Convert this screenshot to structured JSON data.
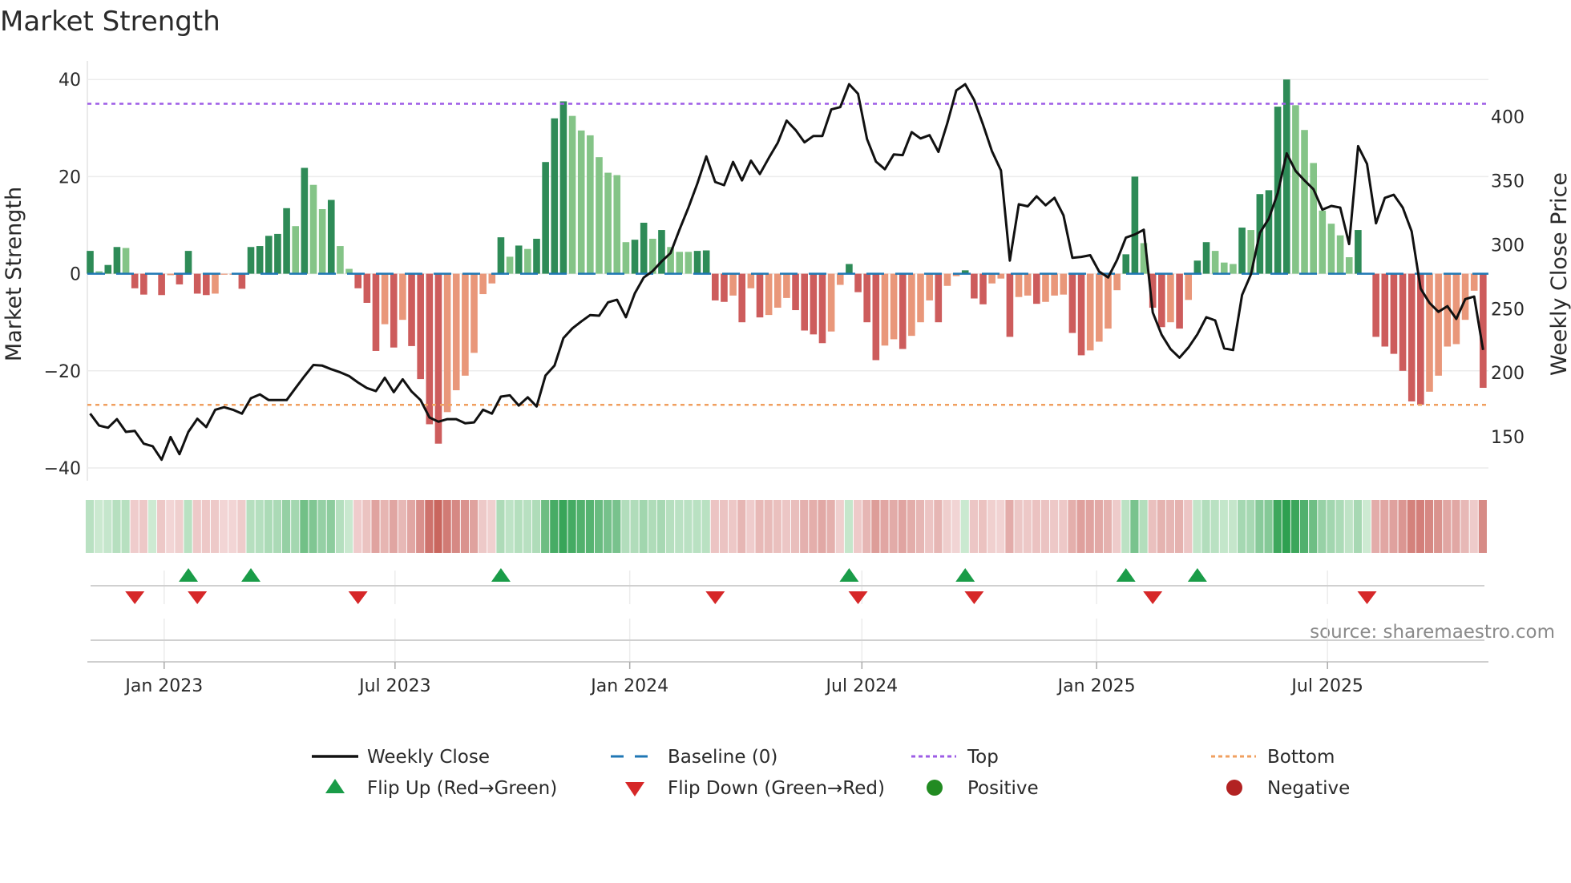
{
  "chart_data": {
    "type": "bar",
    "title": "Market Strength",
    "ylabel": "Market Strength",
    "y2label": "Weekly Close Price",
    "ylim": [
      -42,
      42
    ],
    "y2lim": [
      120,
      430
    ],
    "yticks": [
      40,
      20,
      0,
      -20,
      -40
    ],
    "yticklabels": [
      "40",
      "20",
      "0",
      "−20",
      "−40"
    ],
    "y2ticks": [
      400,
      350,
      300,
      250,
      200,
      150
    ],
    "y2ticklabels": [
      "400",
      "350",
      "300",
      "250",
      "200",
      "150"
    ],
    "x_start": "2022-11-04",
    "x_step_days": 7,
    "xticks": [
      "2023-01-01",
      "2023-07-01",
      "2024-01-01",
      "2024-07-01",
      "2025-01-01",
      "2025-07-01"
    ],
    "xticklabels": [
      "Jan 2023",
      "Jul 2023",
      "Jan 2024",
      "Jul 2024",
      "Jan 2025",
      "Jul 2025"
    ],
    "grid": true,
    "top_level": 35,
    "bottom_level": -27,
    "baseline": 0,
    "series": [
      {
        "name": "Market Strength",
        "values": [
          4.7,
          0.5,
          1.8,
          5.5,
          5.3,
          -3,
          -4.3,
          0,
          -4.4,
          -0.3,
          -2.2,
          4.7,
          -4.1,
          -4.4,
          -4.1,
          -0.2,
          -0.2,
          -3.1,
          5.5,
          5.7,
          7.8,
          8.2,
          13.5,
          9.8,
          21.8,
          18.3,
          13.3,
          15.2,
          5.7,
          1.0,
          -3,
          -6,
          -15.9,
          -10.4,
          -15.2,
          -9.5,
          -14.9,
          -21.7,
          -31,
          -35,
          -28.5,
          -24,
          -21,
          -16.3,
          -4.2,
          -2,
          7.5,
          3.5,
          5.8,
          5.1,
          7.2,
          23,
          32,
          35.5,
          32.5,
          29.5,
          28.5,
          24,
          20.8,
          20.3,
          6.5,
          7,
          10.5,
          7.2,
          9,
          5.5,
          4.5,
          4.5,
          4.7,
          4.8,
          -5.5,
          -5.8,
          -4.5,
          -10,
          -3,
          -9,
          -8.5,
          -7,
          -5,
          -7.5,
          -11.7,
          -12.5,
          -14.3,
          -11.9,
          -2.3,
          2,
          -3.8,
          -10,
          -17.8,
          -14.8,
          -13.5,
          -15.5,
          -12.8,
          -10,
          -5.5,
          -10,
          -2.5,
          -0.5,
          0.7,
          -5.1,
          -6.3,
          -2,
          -1,
          -13,
          -4.8,
          -4.5,
          -6.2,
          -5.8,
          -4.5,
          -4.3,
          -12.2,
          -16.8,
          -15.8,
          -14,
          -11.3,
          -3.4,
          4,
          20,
          6.3,
          -7,
          -11,
          -10,
          -11.3,
          -5.4,
          2.7,
          6.5,
          4.7,
          2.3,
          2,
          9.5,
          9,
          16.4,
          17.2,
          34.4,
          40,
          34.7,
          29.6,
          22.8,
          13,
          10.3,
          7.9,
          3.4,
          9,
          0,
          -13,
          -15,
          -16.5,
          -20,
          -26.3,
          -27,
          -24.3,
          -21,
          -15,
          -14.5,
          -9.5,
          -3.5,
          -23.5
        ],
        "shade": [
          "d",
          "l",
          "d",
          "d",
          "l",
          "d",
          "d",
          "d",
          "d",
          "l",
          "d",
          "d",
          "d",
          "d",
          "l",
          "l",
          "l",
          "d",
          "d",
          "d",
          "d",
          "d",
          "d",
          "l",
          "d",
          "l",
          "l",
          "d",
          "l",
          "l",
          "d",
          "d",
          "d",
          "l",
          "d",
          "l",
          "d",
          "d",
          "d",
          "d",
          "l",
          "l",
          "l",
          "l",
          "l",
          "l",
          "d",
          "l",
          "d",
          "l",
          "d",
          "d",
          "d",
          "d",
          "l",
          "l",
          "l",
          "l",
          "l",
          "l",
          "l",
          "d",
          "d",
          "l",
          "d",
          "l",
          "l",
          "l",
          "d",
          "d",
          "d",
          "d",
          "l",
          "d",
          "l",
          "d",
          "l",
          "l",
          "l",
          "d",
          "d",
          "d",
          "d",
          "l",
          "l",
          "d",
          "d",
          "d",
          "d",
          "l",
          "l",
          "d",
          "l",
          "l",
          "l",
          "d",
          "l",
          "l",
          "d",
          "d",
          "d",
          "l",
          "l",
          "d",
          "l",
          "l",
          "d",
          "l",
          "l",
          "l",
          "d",
          "d",
          "l",
          "l",
          "l",
          "l",
          "d",
          "d",
          "l",
          "d",
          "d",
          "l",
          "d",
          "l",
          "d",
          "d",
          "l",
          "l",
          "l",
          "d",
          "l",
          "d",
          "d",
          "d",
          "d",
          "l",
          "l",
          "l",
          "l",
          "l",
          "l",
          "l",
          "d",
          "d",
          "d",
          "d",
          "d",
          "d",
          "d",
          "d",
          "l",
          "l",
          "l",
          "l",
          "l",
          "l",
          "d"
        ]
      },
      {
        "name": "Weekly Close",
        "axis": "right",
        "values": [
          168,
          158.7,
          157,
          163.7,
          153.7,
          154.5,
          144.5,
          142.5,
          132,
          149.7,
          136.3,
          153.7,
          164,
          157.5,
          171,
          173,
          171,
          168,
          180,
          183,
          178.6,
          178.6,
          178.6,
          188,
          197.3,
          206,
          205.5,
          202.7,
          200.3,
          197.3,
          192.3,
          188,
          185.6,
          196,
          184.8,
          194.8,
          185.3,
          178.6,
          165,
          161.7,
          163.7,
          163.7,
          160.5,
          161.2,
          171,
          168,
          181.3,
          182.3,
          174.3,
          180.8,
          173.6,
          197.8,
          205.5,
          227,
          234.6,
          240,
          245,
          244.5,
          255,
          257,
          243.3,
          262,
          274.4,
          279.4,
          287,
          293.5,
          311.7,
          329,
          347.8,
          369,
          349,
          346.5,
          364.7,
          350.2,
          365.7,
          355.2,
          367.7,
          379.6,
          397,
          389.6,
          380,
          385,
          385,
          405.7,
          407.5,
          425.4,
          418,
          382.6,
          365,
          359,
          370.6,
          370,
          388,
          383,
          385.6,
          372.6,
          395,
          420.6,
          425.4,
          413,
          393.8,
          373,
          358,
          287.6,
          331.6,
          330,
          337.8,
          330.8,
          336.6,
          323,
          289.8,
          290.5,
          291.8,
          279,
          274.4,
          288,
          305.5,
          308,
          311.7,
          247,
          229.6,
          218.4,
          211.7,
          219.6,
          230,
          243.3,
          240.8,
          219,
          217.7,
          260.7,
          276.9,
          309.2,
          320.4,
          340.3,
          371.4,
          357.7,
          350.2,
          343.3,
          327.4,
          330.3,
          329,
          300.5,
          377,
          363.2,
          316.7,
          336.6,
          339,
          329,
          310.4,
          265.7,
          254.5,
          247.5,
          252,
          242,
          257.5,
          259.5,
          217.7
        ]
      }
    ],
    "flip_up_weeks": [
      11,
      18,
      46,
      85,
      98,
      116,
      124
    ],
    "flip_down_weeks": [
      5,
      12,
      30,
      70,
      86,
      99,
      119,
      143
    ],
    "legend": {
      "placement": "bottom",
      "items": [
        "Weekly Close",
        "Baseline (0)",
        "Top",
        "Bottom",
        "Flip Up (Red→Green)",
        "Flip Down (Green→Red)",
        "Positive",
        "Negative"
      ]
    },
    "annotation": "source: sharemaestro.com",
    "colors": {
      "pos_dark": "#2e8b57",
      "pos_light": "#84c487",
      "neg_dark": "#cd5c5c",
      "neg_light": "#e9977a",
      "line": "#111111",
      "baseline": "#1f77b4",
      "top": "#9d5ce6",
      "bottom": "#f0a060",
      "flip_up": "#1a9c48",
      "flip_down": "#d62728",
      "positive": "#228b22",
      "negative": "#b22222"
    }
  }
}
